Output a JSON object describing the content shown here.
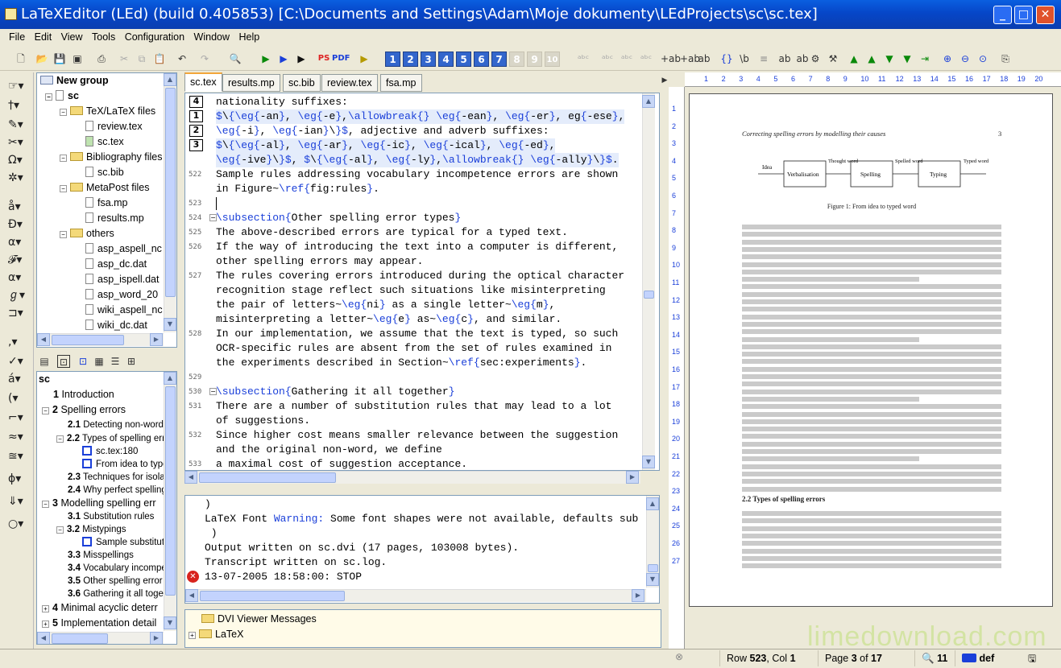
{
  "window": {
    "title": "LaTeXEditor (LEd) (build 0.405853) [C:\\Documents and Settings\\Adam\\Moje dokumenty\\LEdProjects\\sc\\sc.tex]"
  },
  "menu": [
    "File",
    "Edit",
    "View",
    "Tools",
    "Configuration",
    "Window",
    "Help"
  ],
  "toolbar": {
    "ps_label": "PS",
    "pdf_label": "PDF",
    "bookmarks": [
      "1",
      "2",
      "3",
      "4",
      "5",
      "6",
      "7",
      "8",
      "9",
      "10"
    ]
  },
  "project_tree": {
    "root": "New group",
    "project": "sc",
    "items": [
      {
        "label": "TeX/LaTeX files",
        "type": "folder"
      },
      {
        "label": "review.tex",
        "type": "file"
      },
      {
        "label": "sc.tex",
        "type": "file"
      },
      {
        "label": "Bibliography files",
        "type": "folder"
      },
      {
        "label": "sc.bib",
        "type": "file"
      },
      {
        "label": "MetaPost files",
        "type": "folder"
      },
      {
        "label": "fsa.mp",
        "type": "file"
      },
      {
        "label": "results.mp",
        "type": "file"
      },
      {
        "label": "others",
        "type": "folder"
      },
      {
        "label": "asp_aspell_nc",
        "type": "file"
      },
      {
        "label": "asp_dc.dat",
        "type": "file"
      },
      {
        "label": "asp_ispell.dat",
        "type": "file"
      },
      {
        "label": "asp_word_20",
        "type": "file"
      },
      {
        "label": "wiki_aspell_nc",
        "type": "file"
      },
      {
        "label": "wiki_dc.dat",
        "type": "file"
      }
    ]
  },
  "outline": {
    "root": "sc",
    "items": [
      {
        "num": "1",
        "label": "Introduction",
        "level": 1
      },
      {
        "num": "2",
        "label": "Spelling errors",
        "level": 1
      },
      {
        "num": "2.1",
        "label": "Detecting non-word",
        "level": 2
      },
      {
        "num": "2.2",
        "label": "Types of spelling err",
        "level": 2
      },
      {
        "num": "",
        "label": "sc.tex:180",
        "level": 3
      },
      {
        "num": "",
        "label": "From idea to type",
        "level": 3
      },
      {
        "num": "2.3",
        "label": "Techniques for isola",
        "level": 2
      },
      {
        "num": "2.4",
        "label": "Why perfect spelling",
        "level": 2
      },
      {
        "num": "3",
        "label": "Modelling spelling err",
        "level": 1
      },
      {
        "num": "3.1",
        "label": "Substitution rules",
        "level": 2
      },
      {
        "num": "3.2",
        "label": "Mistypings",
        "level": 2
      },
      {
        "num": "",
        "label": "Sample substitutio",
        "level": 3
      },
      {
        "num": "3.3",
        "label": "Misspellings",
        "level": 2
      },
      {
        "num": "3.4",
        "label": "Vocabulary incompet",
        "level": 2
      },
      {
        "num": "3.5",
        "label": "Other spelling error",
        "level": 2
      },
      {
        "num": "3.6",
        "label": "Gathering it all toget",
        "level": 2
      },
      {
        "num": "4",
        "label": "Minimal acyclic deterr",
        "level": 1
      },
      {
        "num": "5",
        "label": "Implementation detail",
        "level": 1
      }
    ]
  },
  "tabs": [
    "sc.tex",
    "results.mp",
    "sc.bib",
    "review.tex",
    "fsa.mp"
  ],
  "editor": {
    "lines": [
      {
        "ln": "",
        "bm": "4",
        "text": "nationality suffixes:",
        "hl": false
      },
      {
        "ln": "",
        "bm": "1",
        "text": "$\\{\\eg{-an}, \\eg{-e},\\allowbreak{} \\eg{-ean}, \\eg{-er}, eg{-ese},",
        "hl": true
      },
      {
        "ln": "",
        "bm": "2",
        "text": "\\eg{-i}, \\eg{-ian}\\}$, adjective and adverb suffixes:",
        "hl": false
      },
      {
        "ln": "",
        "bm": "3",
        "text": "$\\{\\eg{-al}, \\eg{-ar}, \\eg{-ic}, \\eg{-ical}, \\eg{-ed},",
        "hl": true
      },
      {
        "ln": "",
        "bm": "",
        "text": "\\eg{-ive}\\}$, $\\{\\eg{-al}, \\eg{-ly},\\allowbreak{} \\eg{-ally}\\}$.",
        "hl": true
      },
      {
        "ln": "522",
        "bm": "",
        "text": "Sample rules addressing vocabulary incompetence errors are shown",
        "hl": false
      },
      {
        "ln": "",
        "bm": "",
        "text": "in Figure~\\ref{fig:rules}.",
        "hl": false
      },
      {
        "ln": "523",
        "bm": "",
        "text": "",
        "hl": false
      },
      {
        "ln": "524",
        "bm": "",
        "text": "\\subsection{Other spelling error types}",
        "hl": false
      },
      {
        "ln": "525",
        "bm": "",
        "text": "The above-described errors are typical for a typed text.",
        "hl": false
      },
      {
        "ln": "526",
        "bm": "",
        "text": "If the way of introducing the text into a computer is different,",
        "hl": false
      },
      {
        "ln": "",
        "bm": "",
        "text": "other spelling errors may appear.",
        "hl": false
      },
      {
        "ln": "527",
        "bm": "",
        "text": "The rules covering errors introduced during the optical character",
        "hl": false
      },
      {
        "ln": "",
        "bm": "",
        "text": "recognition stage reflect such situations like misinterpreting",
        "hl": false
      },
      {
        "ln": "",
        "bm": "",
        "text": "the pair of letters~\\eg{ni} as a single letter~\\eg{m},",
        "hl": false
      },
      {
        "ln": "",
        "bm": "",
        "text": "misinterpreting a letter~\\eg{e} as~\\eg{c}, and similar.",
        "hl": false
      },
      {
        "ln": "528",
        "bm": "",
        "text": "In our implementation, we assume that the text is typed, so such",
        "hl": false
      },
      {
        "ln": "",
        "bm": "",
        "text": "OCR-specific rules are absent from the set of rules examined in",
        "hl": false
      },
      {
        "ln": "",
        "bm": "",
        "text": "the experiments described in Section~\\ref{sec:experiments}.",
        "hl": false
      },
      {
        "ln": "529",
        "bm": "",
        "text": "",
        "hl": false
      },
      {
        "ln": "530",
        "bm": "",
        "text": "\\subsection{Gathering it all together}",
        "hl": false
      },
      {
        "ln": "531",
        "bm": "",
        "text": "There are a number of substitution rules that may lead to a lot",
        "hl": false
      },
      {
        "ln": "",
        "bm": "",
        "text": "of suggestions.",
        "hl": false
      },
      {
        "ln": "532",
        "bm": "",
        "text": "Since higher cost means smaller relevance between the suggestion",
        "hl": false
      },
      {
        "ln": "",
        "bm": "",
        "text": "and the original non-word, we define",
        "hl": false
      },
      {
        "ln": "533",
        "bm": "",
        "text": "a maximal cost of suggestion acceptance.",
        "hl": false
      }
    ]
  },
  "log": {
    "lines": [
      ")",
      "LaTeX Font Warning: Some font shapes were not available, defaults sub",
      " )",
      "Output written on sc.dvi (17 pages, 103008 bytes).",
      "Transcript written on sc.log.",
      "13-07-2005 18:58:00: STOP"
    ]
  },
  "messages": {
    "items": [
      "DVI Viewer Messages",
      "LaTeX"
    ]
  },
  "preview": {
    "ruler_h": [
      "1",
      "2",
      "3",
      "4",
      "5",
      "6",
      "7",
      "8",
      "9",
      "10",
      "11",
      "12",
      "13",
      "14",
      "15",
      "16",
      "17",
      "18",
      "19",
      "20"
    ],
    "ruler_v": [
      "1",
      "2",
      "3",
      "4",
      "5",
      "6",
      "7",
      "8",
      "9",
      "10",
      "11",
      "12",
      "13",
      "14",
      "15",
      "16",
      "17",
      "18",
      "19",
      "20",
      "21",
      "22",
      "23",
      "24",
      "25",
      "26",
      "27"
    ],
    "header_title": "Correcting spelling errors by modelling their causes",
    "page_no": "3",
    "diagram": {
      "nodes": [
        "Verbalisation",
        "Spelling",
        "Typing"
      ],
      "edges": [
        "Idea",
        "Thought word",
        "Spelled word",
        "Typed word"
      ]
    },
    "figure_caption": "Figure 1: From idea to typed word",
    "section_heading": "2.2   Types of spelling errors"
  },
  "status": {
    "row_label": "Row",
    "row": "523",
    "col_label": "Col",
    "col": "1",
    "page_label": "Page",
    "page": "3",
    "of_label": "of",
    "pages": "17",
    "zoom": "11",
    "keyboard": "def"
  },
  "watermark": "limedownload.com"
}
